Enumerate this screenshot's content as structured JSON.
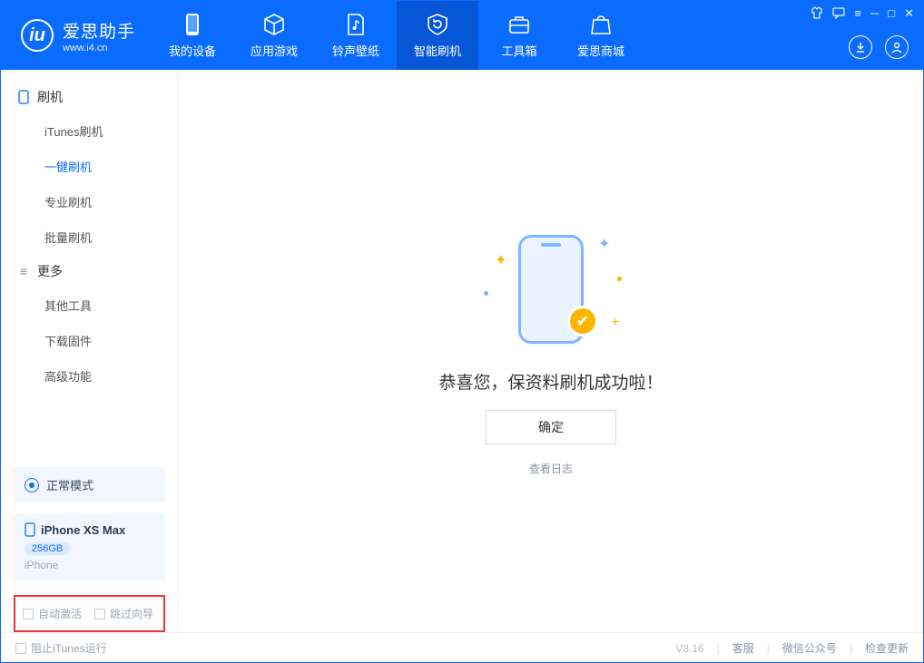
{
  "app": {
    "name_cn": "爱思助手",
    "url": "www.i4.cn"
  },
  "nav": {
    "my_device": "我的设备",
    "apps_games": "应用游戏",
    "ring_wall": "铃声壁纸",
    "smart_flash": "智能刷机",
    "toolbox": "工具箱",
    "store": "爱思商城"
  },
  "sidebar": {
    "group_flash": "刷机",
    "items_flash": {
      "itunes": "iTunes刷机",
      "onekey": "一键刷机",
      "pro": "专业刷机",
      "batch": "批量刷机"
    },
    "group_more": "更多",
    "items_more": {
      "other_tools": "其他工具",
      "download_fw": "下载固件",
      "advanced": "高级功能"
    },
    "mode_label": "正常模式",
    "device": {
      "name": "iPhone XS Max",
      "capacity": "256GB",
      "type": "iPhone"
    },
    "checks": {
      "auto_activate": "自动激活",
      "skip_guide": "跳过向导"
    }
  },
  "main": {
    "success_text": "恭喜您，保资料刷机成功啦！",
    "ok": "确定",
    "view_log": "查看日志"
  },
  "footer": {
    "block_itunes": "阻止iTunes运行",
    "version": "V8.16",
    "support": "客服",
    "wechat": "微信公众号",
    "update": "检查更新"
  }
}
